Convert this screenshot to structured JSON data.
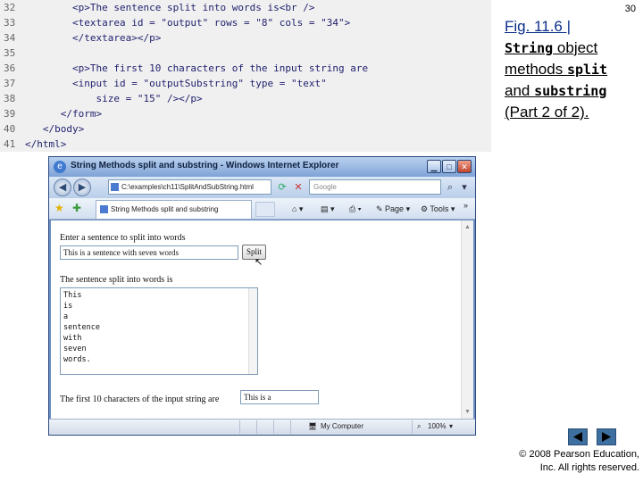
{
  "code": {
    "lines": [
      {
        "num": "32",
        "text": "        <p>The sentence split into words is<br />"
      },
      {
        "num": "33",
        "text": "        <textarea id = \"output\" rows = \"8\" cols = \"34\">"
      },
      {
        "num": "34",
        "text": "        </textarea></p>"
      },
      {
        "num": "35",
        "text": ""
      },
      {
        "num": "36",
        "text": "        <p>The first 10 characters of the input string are"
      },
      {
        "num": "37",
        "text": "        <input id = \"outputSubstring\" type = \"text\""
      },
      {
        "num": "38",
        "text": "            size = \"15\" /></p>"
      },
      {
        "num": "39",
        "text": "      </form>"
      },
      {
        "num": "40",
        "text": "   </body>"
      },
      {
        "num": "41",
        "text": "</html>"
      }
    ]
  },
  "slide": {
    "page_number": "30",
    "caption": {
      "fig": "Fig. 11.6 |",
      "string_word": "String",
      "object_text": " object methods ",
      "split_word": "split",
      "and_text": "and ",
      "substring_word": "substring",
      "part_text": "(Part 2 of 2)."
    },
    "copyright_line1": "© 2008 Pearson Education,",
    "copyright_line2": "Inc. All rights reserved."
  },
  "browser": {
    "title": "String Methods split and substring - Windows Internet Explorer",
    "address": "C:\\examples\\ch11\\SplitAndSubString.html",
    "search_placeholder": "Google",
    "tab_title": "String Methods split and substring",
    "page_label": "Page",
    "tools_label": "Tools",
    "form": {
      "prompt_label": "Enter a sentence to split into words",
      "sentence_value": "This is a sentence with seven words",
      "split_button": "Split",
      "result_label": "The sentence split into words is",
      "words": [
        "This",
        "is",
        "a",
        "sentence",
        "with",
        "seven",
        "words."
      ],
      "substring_label": "The first 10 characters of the input string are",
      "substring_value": "This is a"
    },
    "status": {
      "zone": "My Computer",
      "zoom": "100%"
    }
  }
}
